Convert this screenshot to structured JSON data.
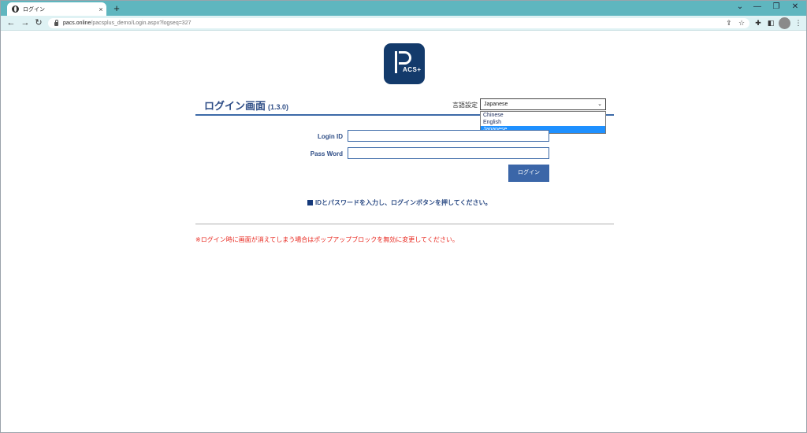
{
  "browser": {
    "tab_title": "ログイン",
    "tab_close": "×",
    "new_tab": "+",
    "url_host": "pacs.online",
    "url_path": "/pacsplus_demo/Login.aspx?logseq=327",
    "window_controls": {
      "tablist": "⌄",
      "minimize": "—",
      "restore": "❐",
      "close": "✕"
    },
    "nav": {
      "back": "←",
      "forward": "→",
      "reload": "↻"
    },
    "toolbar_icons": {
      "share": "⇪",
      "star": "☆",
      "extensions": "✚",
      "sidepanel": "◧",
      "menu": "⋮"
    }
  },
  "logo": {
    "text": "ACS+",
    "bg_color": "#133a6b"
  },
  "header": {
    "title": "ログイン画面",
    "version": "(1.3.0)"
  },
  "language": {
    "label": "言語設定",
    "selected": "Japanese",
    "chevron": "⌄",
    "options": [
      "Chinese",
      "English",
      "Japanese"
    ]
  },
  "form": {
    "login_id_label": "Login ID",
    "password_label": "Pass Word",
    "login_button": "ログイン"
  },
  "notice": "IDとパスワードを入力し、ログインボタンを押してください。",
  "warning": "※ログイン時に画面が消えてしまう場合はポップアップブロックを無効に変更してください。",
  "colors": {
    "accent": "#3b66a8",
    "warning": "#e8271e",
    "tabstrip": "#5fb6bf",
    "selected_option": "#1e90ff"
  }
}
